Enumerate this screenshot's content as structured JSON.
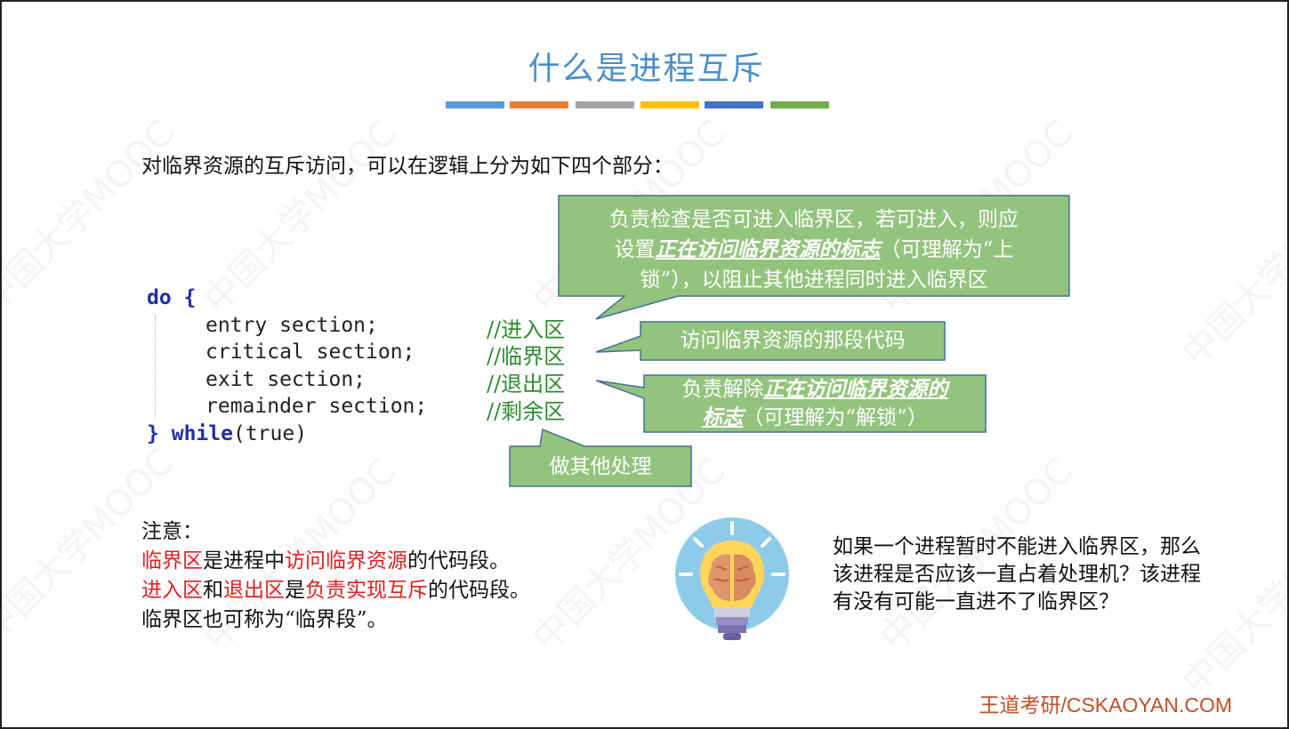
{
  "title": "什么是进程互斥",
  "title_bar_colors": [
    "#5b9bd5",
    "#ed7d31",
    "#a5a5a5",
    "#ffc000",
    "#4472c4",
    "#70ad47"
  ],
  "watermark_text": "中国大学MOOC",
  "intro": "对临界资源的互斥访问，可以在逻辑上分为如下四个部分：",
  "code": {
    "do": "do {",
    "entry": "entry section;",
    "critical": "critical section;",
    "exit": "exit section;",
    "remainder": "remainder section;",
    "close_brace": "}",
    "while_kw": "while",
    "while_cond": "(true)"
  },
  "comments": {
    "entry": "//进入区",
    "critical": "//临界区",
    "exit": "//退出区",
    "remainder": "//剩余区"
  },
  "callouts": {
    "entry_line1": "负责检查是否可进入临界区，若可进入，则应",
    "entry_pre": "设置",
    "entry_em": "正在访问临界资源的标志",
    "entry_post": "（可理解为“上",
    "entry_line3": "锁”），以阻止其他进程同时进入临界区",
    "critical": "访问临界资源的那段代码",
    "exit_pre": "负责解除",
    "exit_em1": "正在访问临界资源的",
    "exit_em2": "标志",
    "exit_post": "（可理解为“解锁”）",
    "remainder": "做其他处理"
  },
  "callout_color": "#93c47d",
  "note": {
    "heading": "注意：",
    "line1_a": "临界区",
    "line1_b": "是进程中",
    "line1_c": "访问临界资源",
    "line1_d": "的代码段。",
    "line2_a": "进入区",
    "line2_b": "和",
    "line2_c": "退出区",
    "line2_d": "是",
    "line2_e": "负责实现互斥",
    "line2_f": "的代码段。",
    "line3": "临界区也可称为“临界段”。"
  },
  "question": "如果一个进程暂时不能进入临界区，那么该进程是否应该一直占着处理机？该进程有没有可能一直进不了临界区？",
  "lightbulb_icon": "lightbulb-brain-icon",
  "footer": "王道考研/CSKAOYAN.COM"
}
